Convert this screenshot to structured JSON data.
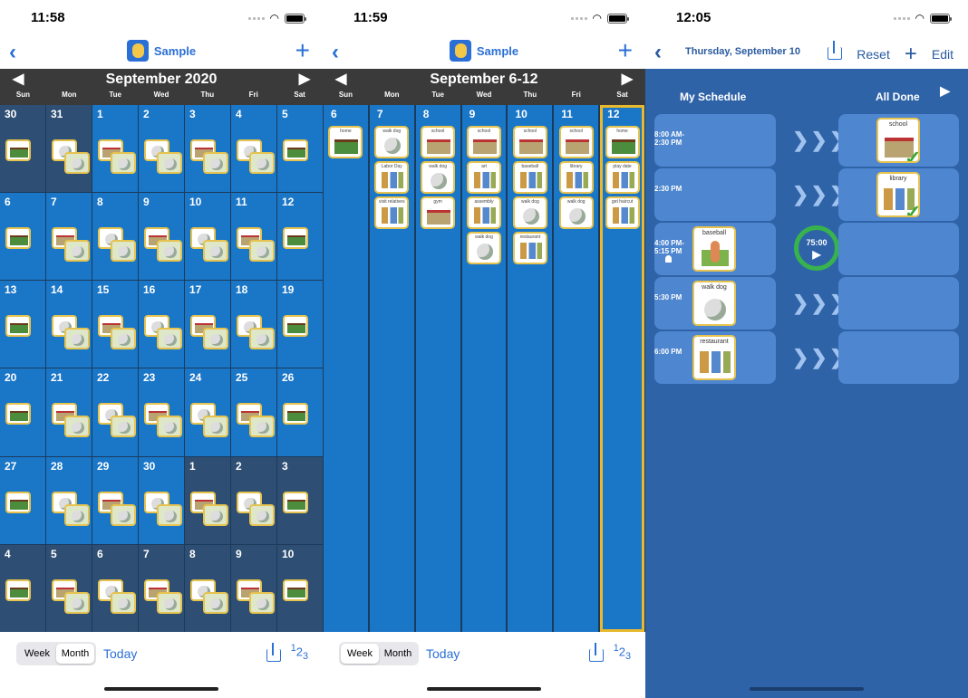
{
  "colors": {
    "accent": "#2a6fd6",
    "calendar_blue": "#1a76c7",
    "dim_cell": "#2e4f73",
    "header_dark": "#3a3a3a",
    "selected_outline": "#e8b92e",
    "schedule_bg": "#2f63a8",
    "timer_green": "#37b24d"
  },
  "panel1": {
    "clock": "11:58",
    "title": "Sample",
    "month_label": "September 2020",
    "prev": "◀",
    "next": "▶",
    "dow": [
      "Sun",
      "Mon",
      "Tue",
      "Wed",
      "Thu",
      "Fri",
      "Sat"
    ],
    "days": [
      "30",
      "31",
      "1",
      "2",
      "3",
      "4",
      "5",
      "6",
      "7",
      "8",
      "9",
      "10",
      "11",
      "12",
      "13",
      "14",
      "15",
      "16",
      "17",
      "18",
      "19",
      "20",
      "21",
      "22",
      "23",
      "24",
      "25",
      "26",
      "27",
      "28",
      "29",
      "30",
      "1",
      "2",
      "3",
      "4",
      "5",
      "6",
      "7",
      "8",
      "9",
      "10"
    ],
    "dim": [
      0,
      1,
      32,
      33,
      34,
      35,
      36,
      37,
      38,
      39,
      40,
      41
    ],
    "first_cell_labels": [
      "beach",
      "walk dog",
      "walk dog",
      "walk dog",
      "walk dog",
      "walk dog",
      "baseball"
    ],
    "tab_week": "Week",
    "tab_month": "Month",
    "today": "Today",
    "num": "1 2 3"
  },
  "panel2": {
    "clock": "11:59",
    "title": "Sample",
    "week_label": "September 6-12",
    "prev": "◀",
    "next": "▶",
    "dow": [
      "Sun",
      "Mon",
      "Tue",
      "Wed",
      "Thu",
      "Fri",
      "Sat"
    ],
    "days": [
      "6",
      "7",
      "8",
      "9",
      "10",
      "11",
      "12"
    ],
    "columns": [
      [
        {
          "t": "home",
          "k": "hm"
        }
      ],
      [
        {
          "t": "walk dog",
          "k": "dog"
        },
        {
          "t": "Labor Day",
          "k": "ppl"
        },
        {
          "t": "visit relatives",
          "k": "ppl"
        }
      ],
      [
        {
          "t": "school",
          "k": "bld"
        },
        {
          "t": "walk dog",
          "k": "dog"
        },
        {
          "t": "gym",
          "k": "bld"
        }
      ],
      [
        {
          "t": "school",
          "k": "bld"
        },
        {
          "t": "art",
          "k": "ppl"
        },
        {
          "t": "assembly",
          "k": "ppl"
        },
        {
          "t": "walk dog",
          "k": "dog"
        }
      ],
      [
        {
          "t": "school",
          "k": "bld"
        },
        {
          "t": "baseball",
          "k": "ppl"
        },
        {
          "t": "walk dog",
          "k": "dog"
        },
        {
          "t": "restaurant",
          "k": "ppl"
        }
      ],
      [
        {
          "t": "school",
          "k": "bld"
        },
        {
          "t": "library",
          "k": "ppl"
        },
        {
          "t": "walk dog",
          "k": "dog"
        }
      ],
      [
        {
          "t": "home",
          "k": "hm"
        },
        {
          "t": "play date",
          "k": "ppl"
        },
        {
          "t": "get haircut",
          "k": "ppl"
        }
      ]
    ],
    "selected_index": 6,
    "tab_week": "Week",
    "tab_month": "Month",
    "today": "Today",
    "num": "1 2 3"
  },
  "panel3": {
    "clock": "12:05",
    "date": "Thursday, September 10",
    "reset": "Reset",
    "edit": "Edit",
    "col_schedule": "My Schedule",
    "col_done": "All Done",
    "rows": [
      {
        "time": "8:00 AM-\n2:30 PM",
        "item": "",
        "state": "done",
        "done_item": "school"
      },
      {
        "time": "2:30 PM",
        "item": "",
        "state": "done",
        "done_item": "library"
      },
      {
        "time": "4:00 PM-\n5:15 PM",
        "item": "baseball",
        "state": "active",
        "timer": "75:00"
      },
      {
        "time": "5:30 PM",
        "item": "walk dog",
        "state": "pending"
      },
      {
        "time": "6:00 PM",
        "item": "restaurant",
        "state": "pending"
      }
    ],
    "chevrons": "❯❯❯",
    "play": "▶"
  }
}
